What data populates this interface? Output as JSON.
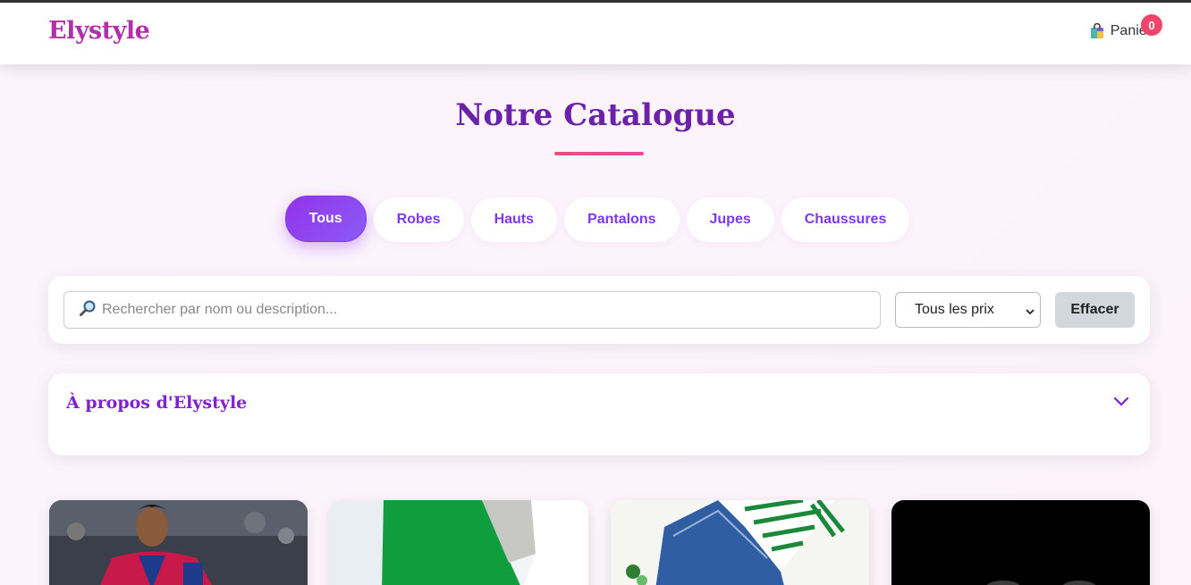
{
  "header": {
    "logo": "Elystyle",
    "cart_label": "Panier",
    "cart_count": "0"
  },
  "catalog": {
    "title": "Notre Catalogue"
  },
  "tabs": [
    {
      "label": "Tous",
      "active": true
    },
    {
      "label": "Robes",
      "active": false
    },
    {
      "label": "Hauts",
      "active": false
    },
    {
      "label": "Pantalons",
      "active": false
    },
    {
      "label": "Jupes",
      "active": false
    },
    {
      "label": "Chaussures",
      "active": false
    }
  ],
  "search": {
    "placeholder": "Rechercher par nom ou description...",
    "value": "",
    "price_filter": "Tous les prix",
    "clear_label": "Effacer"
  },
  "about": {
    "title": "À propos d'Elystyle"
  },
  "colors": {
    "brand": "#b030a8",
    "accent_purple": "#7c3aed",
    "badge": "#f0456a"
  },
  "products": [
    {
      "image": "football-player-photo"
    },
    {
      "image": "green-white-garment-photo"
    },
    {
      "image": "jeans-striped-top-photo"
    },
    {
      "image": "dark-shoes-photo"
    }
  ]
}
